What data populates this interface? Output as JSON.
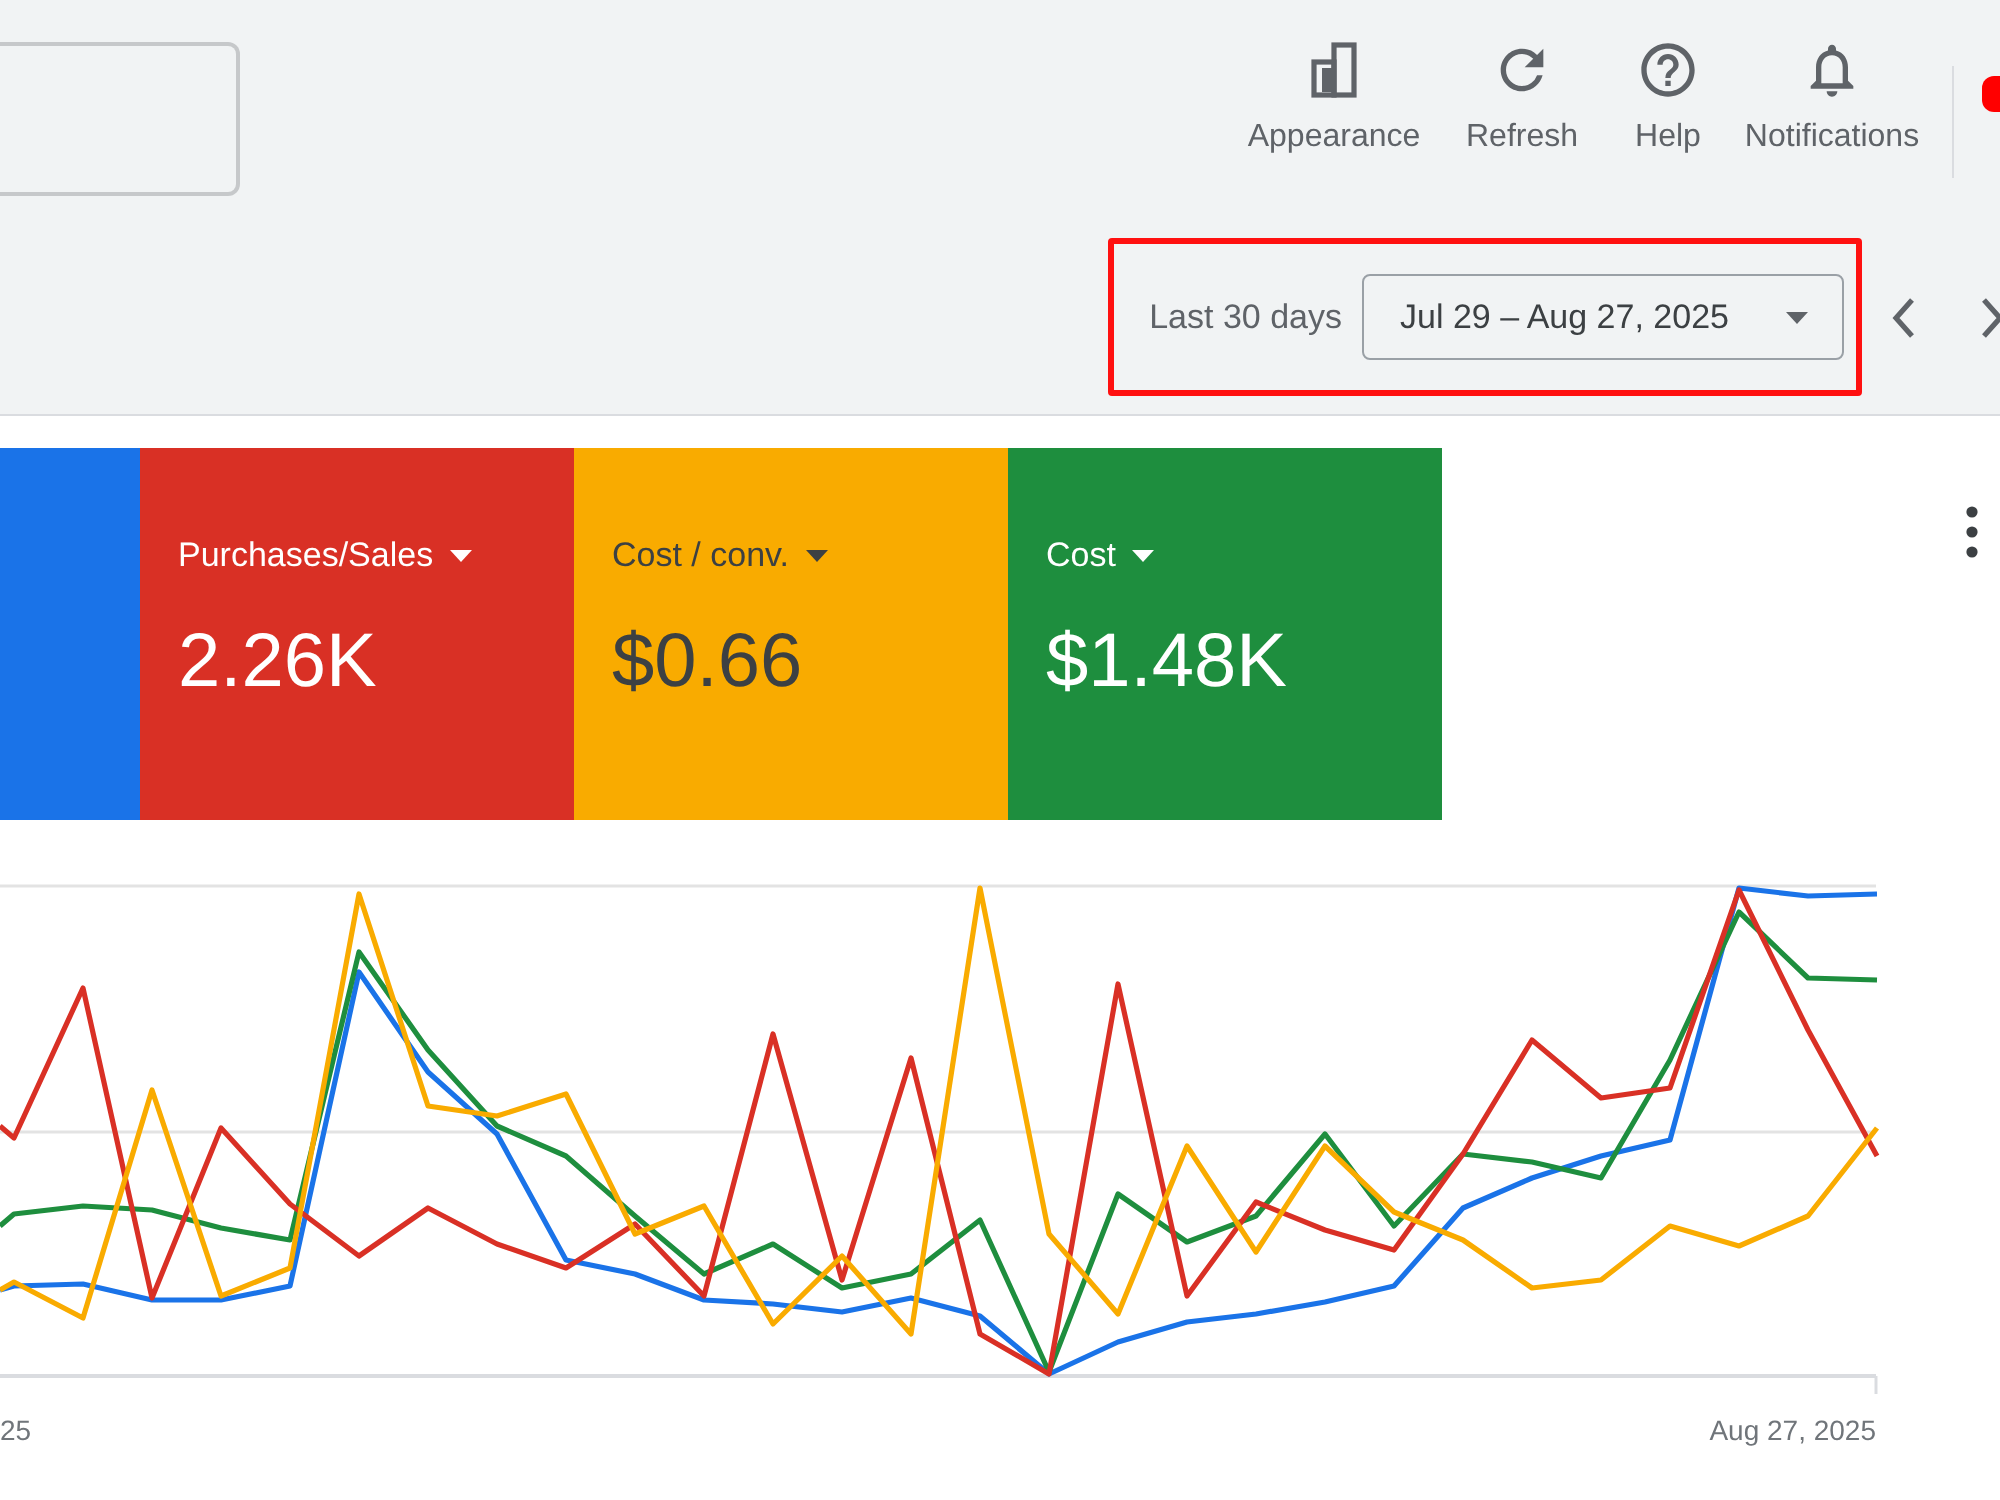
{
  "toolbar": [
    {
      "kind": "appearance",
      "label": "Appearance"
    },
    {
      "kind": "refresh",
      "label": "Refresh"
    },
    {
      "kind": "help",
      "label": "Help"
    },
    {
      "kind": "notifications",
      "label": "Notifications"
    }
  ],
  "date_range": {
    "preset": "Last 30 days",
    "value": "Jul 29 – Aug 27, 2025",
    "highlighted": true
  },
  "metrics": [
    {
      "color": "#1a73e8"
    },
    {
      "label": "Purchases/Sales",
      "value": "2.26K",
      "color": "#d93025"
    },
    {
      "label": "Cost / conv.",
      "value": "$0.66",
      "color": "#f9ab00"
    },
    {
      "label": "Cost",
      "value": "$1.48K",
      "color": "#1e8e3e"
    }
  ],
  "chart": {
    "x_labels": [
      "25",
      "Aug 27, 2025"
    ]
  }
}
